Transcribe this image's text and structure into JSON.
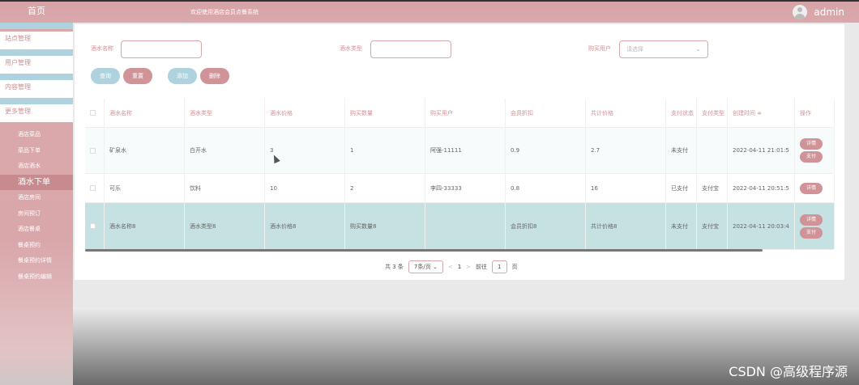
{
  "header": {
    "brand": "首页",
    "welcome": "欢迎使用酒店会员点餐系统",
    "user": "admin"
  },
  "sidebar": {
    "groups": [
      "站点管理",
      "用户管理",
      "内容管理",
      "更多管理"
    ],
    "subitems": [
      "酒店菜品",
      "菜品下单",
      "酒店酒水",
      "酒水下单",
      "酒店房间",
      "房间预订",
      "酒店餐桌",
      "餐桌预约",
      "餐桌预约详情",
      "餐桌预约编辑"
    ],
    "active": "酒水下单"
  },
  "filters": {
    "name_label": "酒水名称",
    "type_label": "酒水类型",
    "buyer_label": "购买用户",
    "buyer_placeholder": "请选择"
  },
  "buttons": {
    "search": "查询",
    "reset": "重置",
    "add": "添加",
    "delete": "删除"
  },
  "table": {
    "headers": [
      "酒水名称",
      "酒水类型",
      "酒水价格",
      "购买数量",
      "购买用户",
      "会员折扣",
      "共计价格",
      "支付状态",
      "支付类型",
      "创建时间 ≑",
      "操作"
    ],
    "rows": [
      {
        "cells": [
          "矿泉水",
          "白开水",
          "3",
          "1",
          "阿强-11111",
          "0.9",
          "2.7",
          "未支付",
          "",
          "2022-04-11 21:01:5"
        ],
        "ops": [
          "详情",
          "支付"
        ]
      },
      {
        "cells": [
          "可乐",
          "饮料",
          "10",
          "2",
          "李四-33333",
          "0.8",
          "16",
          "已支付",
          "支付宝",
          "2022-04-11 20:51:5"
        ],
        "ops": [
          "详情"
        ]
      },
      {
        "cells": [
          "酒水名称8",
          "酒水类型8",
          "酒水价格8",
          "购买数量8",
          "",
          "会员折扣8",
          "共计价格8",
          "未支付",
          "支付宝",
          "2022-04-11 20:03:4"
        ],
        "ops": [
          "详情",
          "支付"
        ]
      }
    ]
  },
  "pager": {
    "total": "共 3 条",
    "page_size": "7条/页",
    "prev": "<",
    "current": "1",
    "next": ">",
    "goto_label": "前往",
    "goto_value": "1",
    "page_unit": "页"
  },
  "watermark": "CSDN @高级程序源"
}
